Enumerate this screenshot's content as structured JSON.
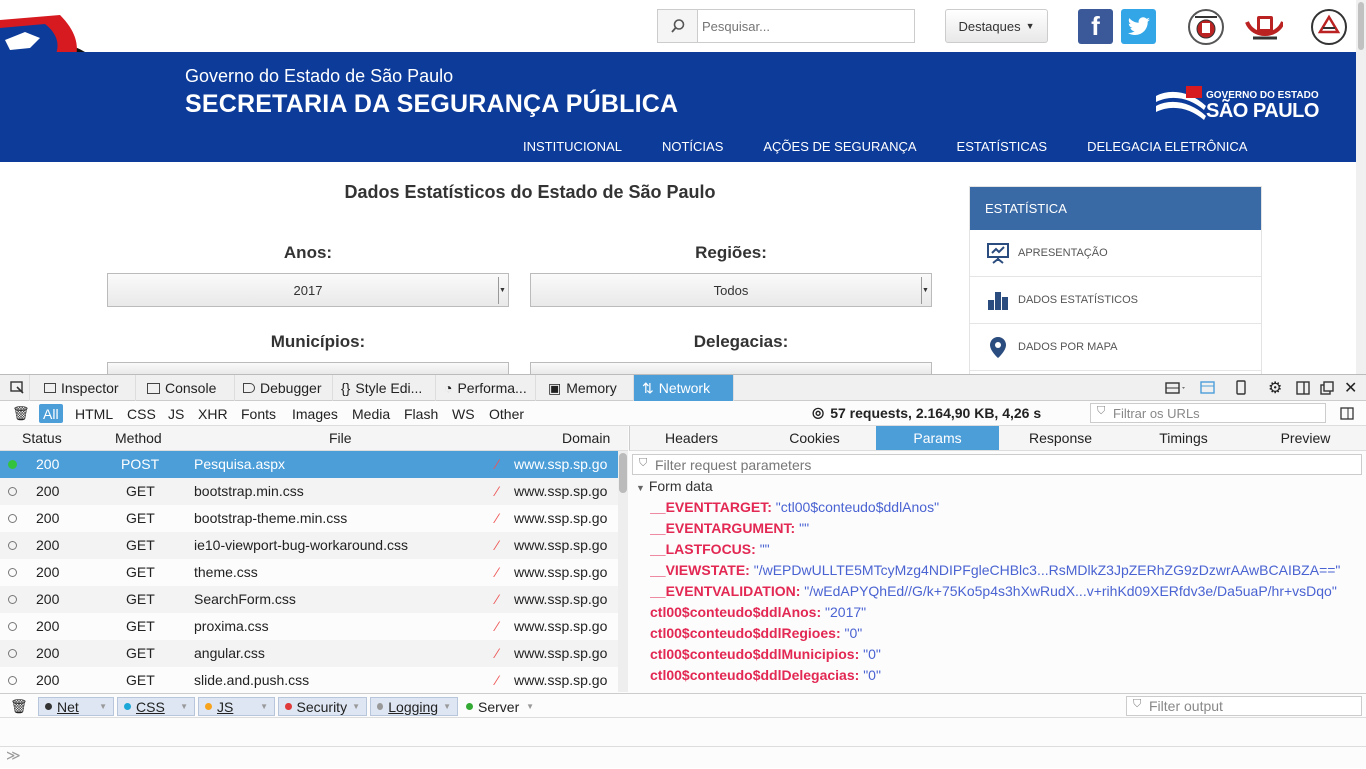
{
  "topbar": {
    "search_placeholder": "Pesquisar...",
    "highlights_label": "Destaques"
  },
  "header": {
    "subtitle": "Governo do Estado de São Paulo",
    "title": "SECRETARIA DA SEGURANÇA PÚBLICA",
    "logo_line1": "GOVERNO DO ESTADO",
    "logo_line2": "SÃO PAULO",
    "nav": [
      "INSTITUCIONAL",
      "NOTÍCIAS",
      "AÇÕES DE SEGURANÇA",
      "ESTATÍSTICAS",
      "DELEGACIA ELETRÔNICA"
    ]
  },
  "main": {
    "title": "Dados Estatísticos do Estado de São Paulo",
    "years_label": "Anos:",
    "years_value": "2017",
    "regions_label": "Regiões:",
    "regions_value": "Todos",
    "municipalities_label": "Municípios:",
    "precincts_label": "Delegacias:"
  },
  "sidebar": {
    "header": "ESTATÍSTICA",
    "items": [
      {
        "label": "APRESENTAÇÃO",
        "icon": "presentation-icon"
      },
      {
        "label": "DADOS ESTATÍSTICOS",
        "icon": "bar-chart-icon"
      },
      {
        "label": "DADOS POR MAPA",
        "icon": "map-pin-icon"
      }
    ]
  },
  "devtools": {
    "tabs": [
      "Inspector",
      "Console",
      "Debugger",
      "Style Edi...",
      "Performa...",
      "Memory",
      "Network"
    ],
    "filters": [
      "All",
      "HTML",
      "CSS",
      "JS",
      "XHR",
      "Fonts",
      "Images",
      "Media",
      "Flash",
      "WS",
      "Other"
    ],
    "summary": "57 requests, 2.164,90 KB, 4,26 s",
    "url_filter_placeholder": "Filtrar os URLs",
    "columns": {
      "status": "Status",
      "method": "Method",
      "file": "File",
      "domain": "Domain"
    },
    "requests": [
      {
        "status": "200",
        "method": "POST",
        "file": "Pesquisa.aspx",
        "domain": "www.ssp.sp.go"
      },
      {
        "status": "200",
        "method": "GET",
        "file": "bootstrap.min.css",
        "domain": "www.ssp.sp.go"
      },
      {
        "status": "200",
        "method": "GET",
        "file": "bootstrap-theme.min.css",
        "domain": "www.ssp.sp.go"
      },
      {
        "status": "200",
        "method": "GET",
        "file": "ie10-viewport-bug-workaround.css",
        "domain": "www.ssp.sp.go"
      },
      {
        "status": "200",
        "method": "GET",
        "file": "theme.css",
        "domain": "www.ssp.sp.go"
      },
      {
        "status": "200",
        "method": "GET",
        "file": "SearchForm.css",
        "domain": "www.ssp.sp.go"
      },
      {
        "status": "200",
        "method": "GET",
        "file": "proxima.css",
        "domain": "www.ssp.sp.go"
      },
      {
        "status": "200",
        "method": "GET",
        "file": "angular.css",
        "domain": "www.ssp.sp.go"
      },
      {
        "status": "200",
        "method": "GET",
        "file": "slide.and.push.css",
        "domain": "www.ssp.sp.go"
      }
    ],
    "panel_tabs": [
      "Headers",
      "Cookies",
      "Params",
      "Response",
      "Timings",
      "Preview"
    ],
    "param_filter_placeholder": "Filter request parameters",
    "form_data_label": "Form data",
    "params": [
      {
        "key": "__EVENTTARGET",
        "value": "\"ctl00$conteudo$ddlAnos\""
      },
      {
        "key": "__EVENTARGUMENT",
        "value": "\"\""
      },
      {
        "key": "__LASTFOCUS",
        "value": "\"\""
      },
      {
        "key": "__VIEWSTATE",
        "value": "\"/wEPDwULLTE5MTcyMzg4NDIPFgleCHBlc3...RsMDlkZ3JpZERhZG9zDzwrAAwBCAIBZA==\""
      },
      {
        "key": "__EVENTVALIDATION",
        "value": "\"/wEdAPYQhEd//G/k+75Ko5p4s3hXwRudX...v+rihKd09XERfdv3e/Da5uaP/hr+vsDqo\""
      },
      {
        "key": "ctl00$conteudo$ddlAnos",
        "value": "\"2017\""
      },
      {
        "key": "ctl00$conteudo$ddlRegioes",
        "value": "\"0\""
      },
      {
        "key": "ctl00$conteudo$ddlMunicipios",
        "value": "\"0\""
      },
      {
        "key": "ctl00$conteudo$ddlDelegacias",
        "value": "\"0\""
      }
    ],
    "console_filters": [
      "Net",
      "CSS",
      "JS",
      "Security",
      "Logging",
      "Server"
    ],
    "console_filter_placeholder": "Filter output",
    "colors": {
      "accent": "#4c9ed9",
      "param_key": "#e22853",
      "param_value": "#4a63d2",
      "header_blue": "#0c3b9a"
    }
  }
}
